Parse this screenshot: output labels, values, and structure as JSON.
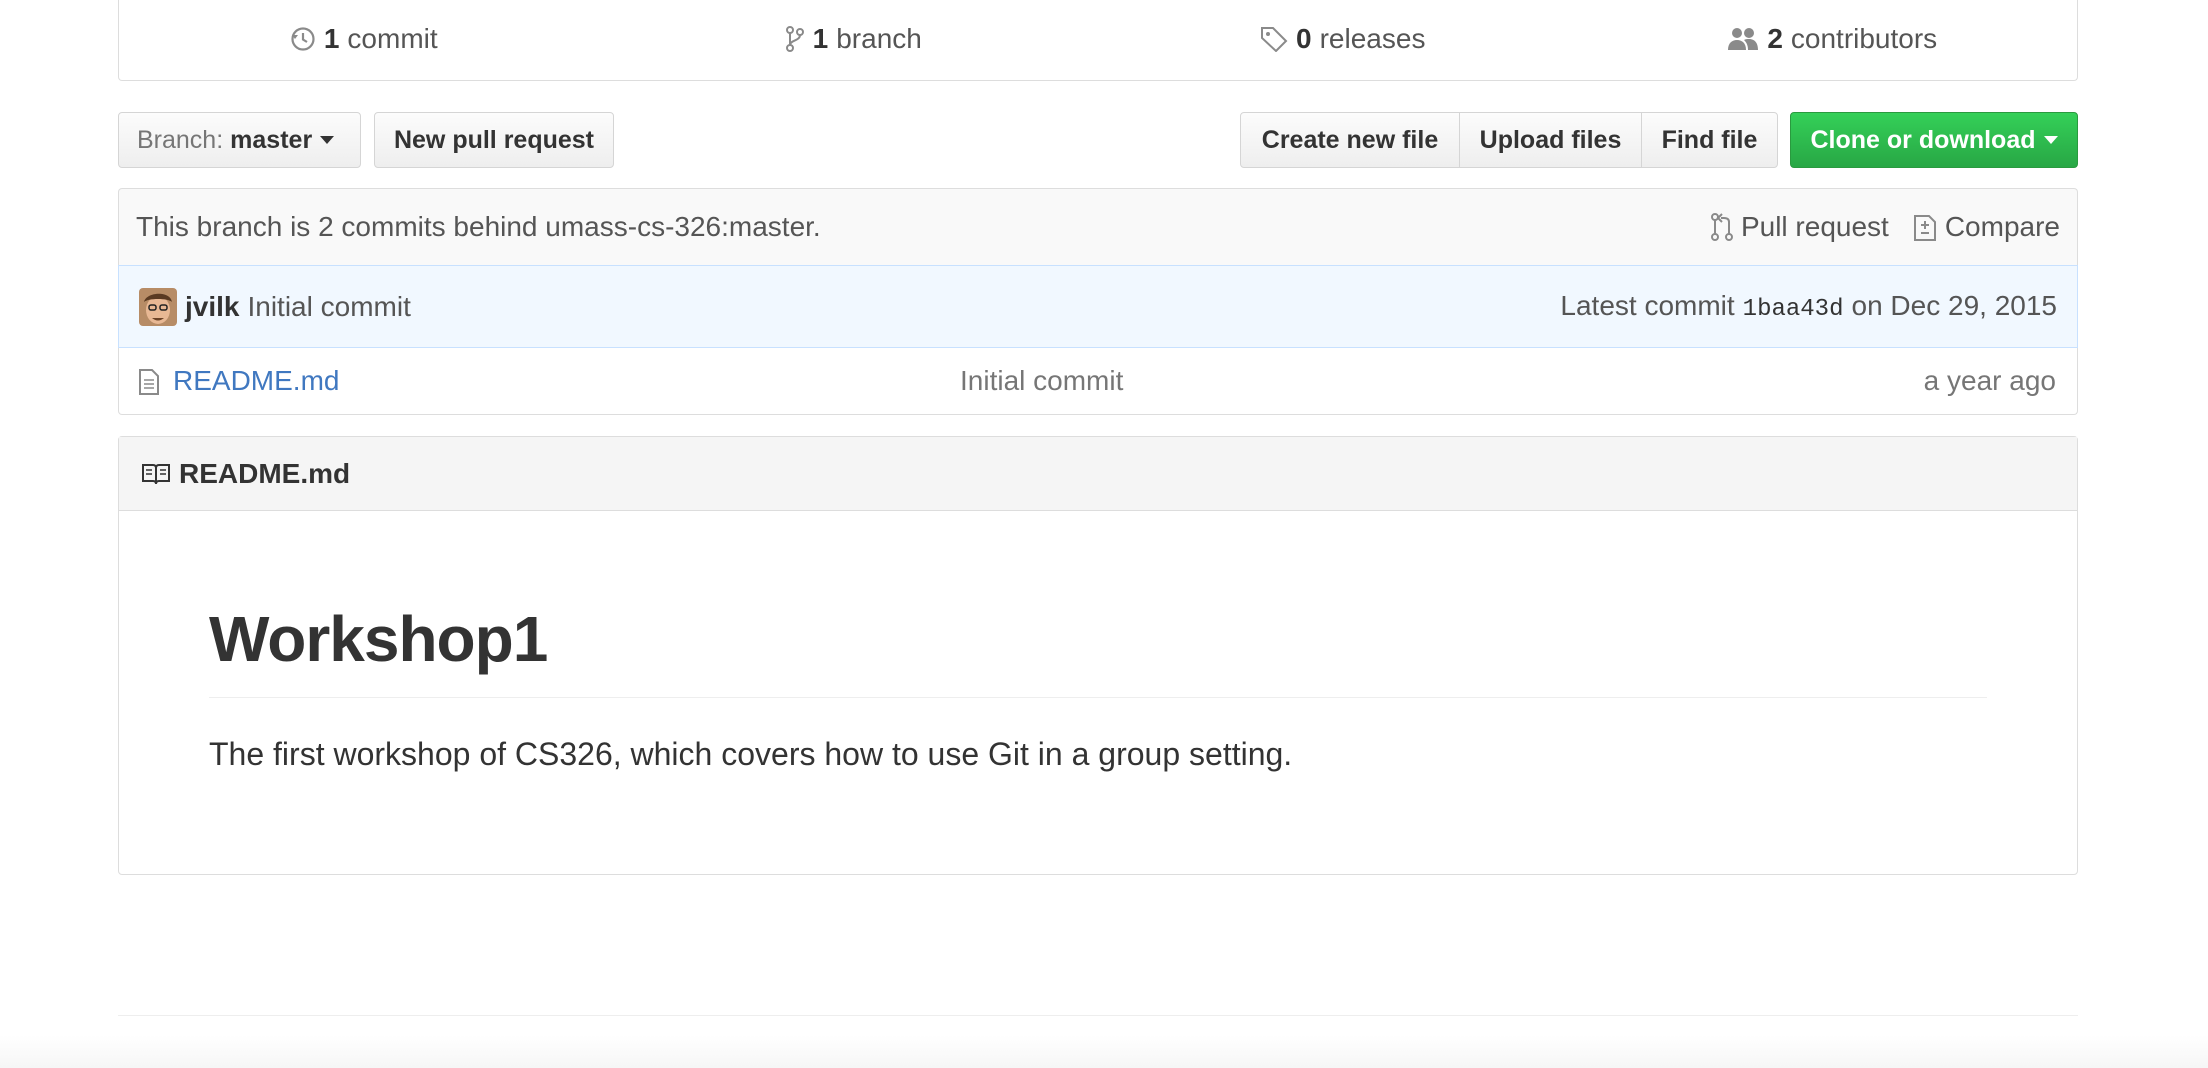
{
  "summary": {
    "commits": {
      "num": "1",
      "label": "commit"
    },
    "branches": {
      "num": "1",
      "label": "branch"
    },
    "releases": {
      "num": "0",
      "label": "releases"
    },
    "contributors": {
      "num": "2",
      "label": "contributors"
    }
  },
  "toolbar": {
    "branch_prefix": "Branch:",
    "branch_name": "master",
    "new_pr": "New pull request",
    "create_file": "Create new file",
    "upload_files": "Upload files",
    "find_file": "Find file",
    "clone": "Clone or download"
  },
  "branch_info": {
    "status": "This branch is 2 commits behind umass-cs-326:master.",
    "pull_request": "Pull request",
    "compare": "Compare"
  },
  "commit": {
    "author": "jvilk",
    "message": "Initial commit",
    "latest_label": "Latest commit",
    "sha": "1baa43d",
    "date": "on Dec 29, 2015"
  },
  "files": [
    {
      "name": "README.md",
      "message": "Initial commit",
      "age": "a year ago"
    }
  ],
  "readme": {
    "header": "README.md",
    "title": "Workshop1",
    "body": "The first workshop of CS326, which covers how to use Git in a group setting."
  },
  "colors": {
    "link": "#4078c0",
    "clone_button": "#28a745",
    "commit_bg": "#f1f8ff"
  }
}
